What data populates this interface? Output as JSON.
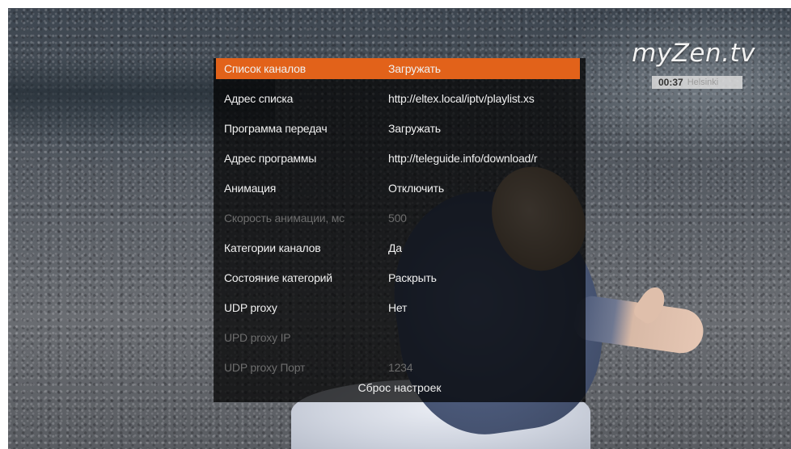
{
  "brand": {
    "logo_text": "myZen.tv",
    "clock_time": "00:37",
    "clock_city": "Helsinki"
  },
  "settings": {
    "items": [
      {
        "label": "Список каналов",
        "value": "Загружать"
      },
      {
        "label": "Адрес списка",
        "value": "http://eltex.local/iptv/playlist.xs"
      },
      {
        "label": "Программа передач",
        "value": "Загружать"
      },
      {
        "label": "Адрес программы",
        "value": "http://teleguide.info/download/r"
      },
      {
        "label": "Анимация",
        "value": "Отключить"
      },
      {
        "label": "Скорость анимации, мс",
        "value": "500"
      },
      {
        "label": "Категории каналов",
        "value": "Да"
      },
      {
        "label": "Состояние категорий",
        "value": "Раскрыть"
      },
      {
        "label": "UDP proxy",
        "value": "Нет"
      },
      {
        "label": "UPD proxy IP",
        "value": ""
      },
      {
        "label": "UDP proxy Порт",
        "value": "1234"
      }
    ],
    "reset_label": "Сброс настроек",
    "highlight_color": "#e2621a"
  }
}
